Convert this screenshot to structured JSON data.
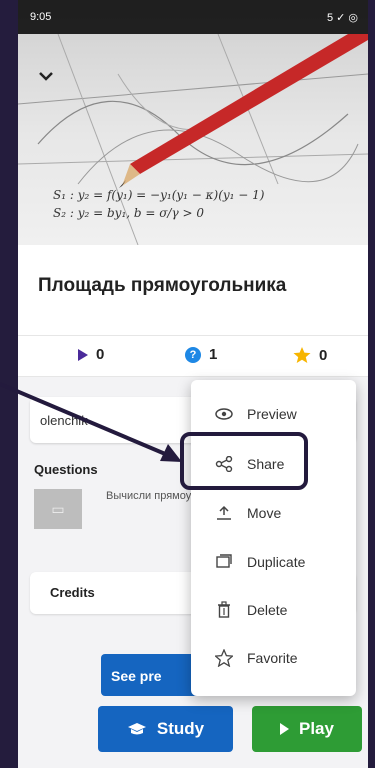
{
  "status_bar": {
    "time": "9:05",
    "icons": "5 ✓ ◎"
  },
  "hero": {
    "formula_1": "S₁ : y₂ = f(y₁) = −y₁(y₁ − κ)(y₁ − 1)",
    "formula_2": "S₂ : y₂ = by₁, b = σ/γ > 0"
  },
  "title": "Площадь прямоугольника",
  "stats": {
    "plays": "0",
    "questions": "1",
    "favorites": "0"
  },
  "owner": {
    "name": "olenchik"
  },
  "questions_section": {
    "label": "Questions",
    "items": [
      {
        "text": "Вычисли прямоуг... 12 см и 14 с..."
      }
    ]
  },
  "credits": {
    "label": "Credits"
  },
  "buttons": {
    "see_preview": "See pre",
    "study": "Study",
    "play": "Play"
  },
  "menu": {
    "items": [
      {
        "label": "Preview",
        "icon": "eye-icon"
      },
      {
        "label": "Share",
        "icon": "share-icon"
      },
      {
        "label": "Move",
        "icon": "move-icon"
      },
      {
        "label": "Duplicate",
        "icon": "duplicate-icon"
      },
      {
        "label": "Delete",
        "icon": "trash-icon"
      },
      {
        "label": "Favorite",
        "icon": "star-icon"
      }
    ]
  },
  "colors": {
    "background": "#241c3d",
    "primary_blue": "#1565c0",
    "play_green": "#2e9c35",
    "question_blue": "#1e88e5",
    "star_yellow": "#f7b500",
    "annotation": "#231a3d"
  }
}
